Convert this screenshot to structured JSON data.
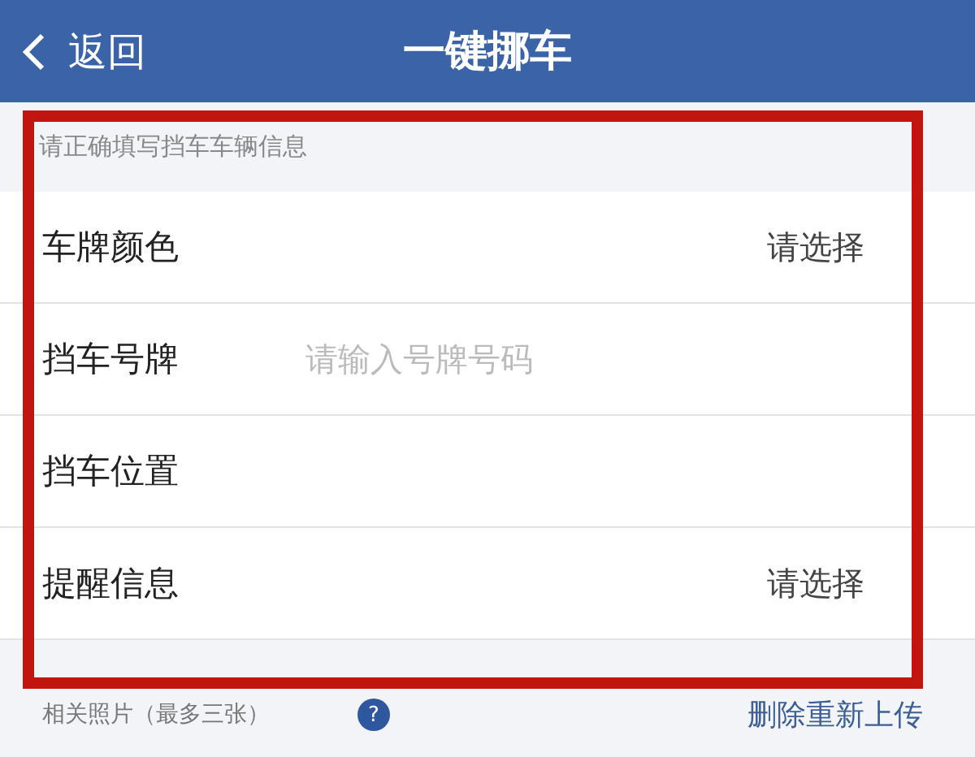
{
  "header": {
    "back_icon_text": "返回",
    "title": "一键挪车"
  },
  "form": {
    "hint": "请正确填写挡车车辆信息",
    "rows": [
      {
        "kind": "select",
        "label": "车牌颜色",
        "value": "请选择"
      },
      {
        "kind": "input",
        "label": "挡车号牌",
        "placeholder": "请输入号牌号码"
      },
      {
        "kind": "plain",
        "label": "挡车位置"
      },
      {
        "kind": "select",
        "label": "提醒信息",
        "value": "请选择"
      }
    ]
  },
  "photos": {
    "label": "相关照片（最多三张）",
    "help": "?",
    "action": "删除重新上传"
  }
}
